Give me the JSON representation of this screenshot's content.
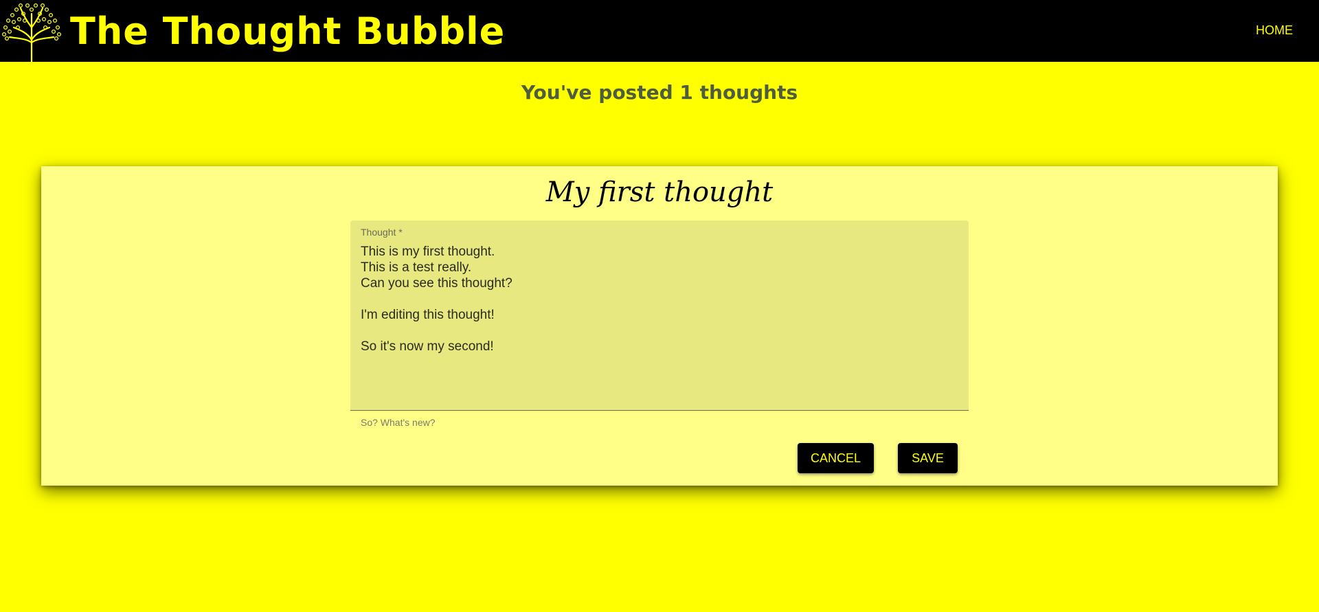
{
  "header": {
    "site_title": "The Thought Bubble",
    "home_label": "HOME",
    "logo_icon": "tree-icon"
  },
  "summary": {
    "posted_text": "You've posted 1 thoughts"
  },
  "thought_card": {
    "title": "My first thought",
    "field": {
      "label": "Thought *",
      "value": "This is my first thought.\nThis is a test really.\nCan you see this thought?\n\nI'm editing this thought!\n\nSo it's now my second!",
      "helper": "So? What's new?"
    },
    "buttons": {
      "cancel_label": "CANCEL",
      "save_label": "SAVE"
    }
  },
  "colors": {
    "page_background": "#ffff00",
    "navbar": "#000000",
    "accent": "#ffff00",
    "card_background": "#ffff88",
    "field_background": "#e8e880",
    "heading_text": "#4d5d3d"
  }
}
